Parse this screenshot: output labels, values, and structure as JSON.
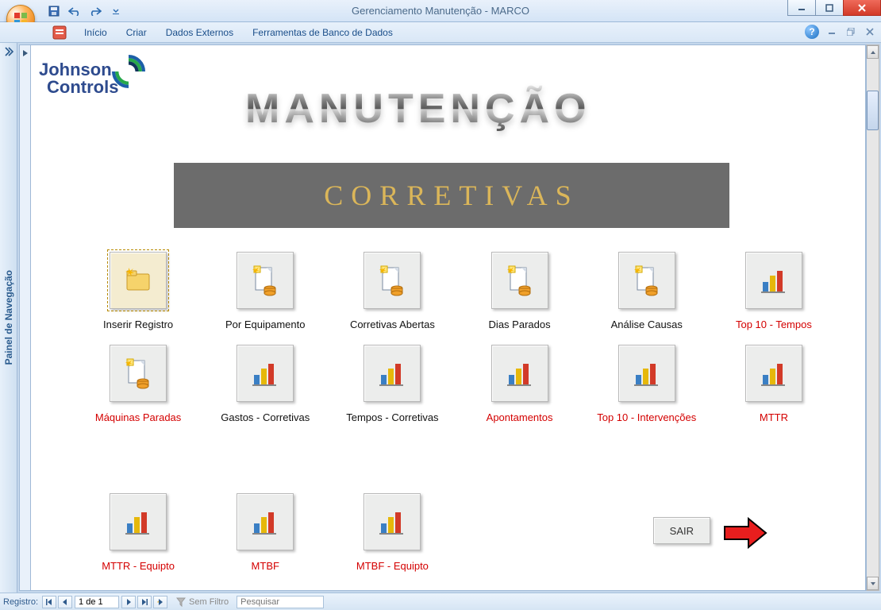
{
  "window": {
    "title": "Gerenciamento Manutenção - MARCO"
  },
  "menubar": {
    "items": [
      "Início",
      "Criar",
      "Dados Externos",
      "Ferramentas de Banco de Dados"
    ]
  },
  "navpane": {
    "label": "Painel de Navegação"
  },
  "logo": {
    "line1": "Johnson",
    "line2": "Controls"
  },
  "banner": {
    "title": "MANUTENÇÃO",
    "subtitle": "CORRETIVAS"
  },
  "buttons": {
    "row1": [
      {
        "label": "Inserir Registro",
        "type": "folder",
        "selected": true,
        "red": false
      },
      {
        "label": "Por Equipamento",
        "type": "report",
        "red": false
      },
      {
        "label": "Corretivas Abertas",
        "type": "report",
        "red": false
      },
      {
        "label": "Dias Parados",
        "type": "report",
        "red": false
      },
      {
        "label": "Análise Causas",
        "type": "report",
        "red": false
      },
      {
        "label": "Top 10 - Tempos",
        "type": "chart",
        "red": true
      }
    ],
    "row2": [
      {
        "label": "Máquinas Paradas",
        "type": "report",
        "red": true
      },
      {
        "label": "Gastos - Corretivas",
        "type": "chart",
        "red": false
      },
      {
        "label": "Tempos - Corretivas",
        "type": "chart",
        "red": false
      },
      {
        "label": "Apontamentos",
        "type": "chart",
        "red": true
      },
      {
        "label": "Top 10 - Intervenções",
        "type": "chart",
        "red": true
      },
      {
        "label": "MTTR",
        "type": "chart",
        "red": true
      }
    ],
    "row3": [
      {
        "label": "MTTR - Equipto",
        "type": "chart",
        "red": true
      },
      {
        "label": "MTBF",
        "type": "chart",
        "red": true
      },
      {
        "label": "MTBF - Equipto",
        "type": "chart",
        "red": true
      }
    ]
  },
  "sair": {
    "label": "SAIR"
  },
  "statusbar": {
    "record_label": "Registro:",
    "record_value": "1 de 1",
    "filter_label": "Sem Filtro",
    "search_placeholder": "Pesquisar"
  }
}
